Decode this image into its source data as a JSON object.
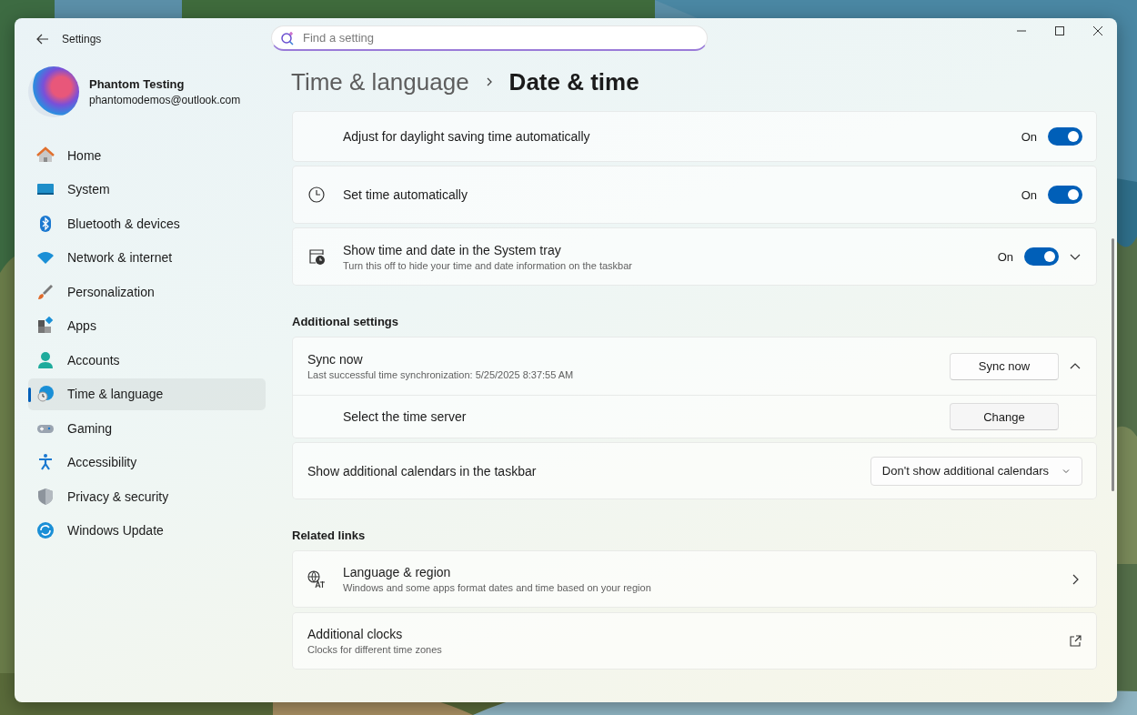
{
  "window": {
    "title": "Settings"
  },
  "search": {
    "placeholder": "Find a setting"
  },
  "account": {
    "name": "Phantom Testing",
    "email": "phantomodemos@outlook.com"
  },
  "sidebar": {
    "items": [
      {
        "label": "Home",
        "selected": false
      },
      {
        "label": "System",
        "selected": false
      },
      {
        "label": "Bluetooth & devices",
        "selected": false
      },
      {
        "label": "Network & internet",
        "selected": false
      },
      {
        "label": "Personalization",
        "selected": false
      },
      {
        "label": "Apps",
        "selected": false
      },
      {
        "label": "Accounts",
        "selected": false
      },
      {
        "label": "Time & language",
        "selected": true
      },
      {
        "label": "Gaming",
        "selected": false
      },
      {
        "label": "Accessibility",
        "selected": false
      },
      {
        "label": "Privacy & security",
        "selected": false
      },
      {
        "label": "Windows Update",
        "selected": false
      }
    ]
  },
  "breadcrumb": {
    "parent": "Time & language",
    "current": "Date & time"
  },
  "content": [
    {
      "kind": "toggle",
      "label": "Adjust for daylight saving time automatically",
      "state_text": "On",
      "on": true
    },
    {
      "kind": "toggle",
      "label": "Set time automatically",
      "state_text": "On",
      "on": true
    },
    {
      "kind": "toggle",
      "label": "Show time and date in the System tray",
      "description": "Turn this off to hide your time and date information on the taskbar",
      "state_text": "On",
      "on": true,
      "expanded": false
    },
    {
      "kind": "section",
      "label": "Additional settings"
    },
    {
      "kind": "expander",
      "label": "Sync now",
      "description": "Last successful time synchronization: 5/25/2025 8:37:55 AM",
      "button": "Sync now",
      "expanded": true,
      "children": [
        {
          "label": "Select the time server",
          "button": "Change"
        }
      ]
    },
    {
      "kind": "dropdown",
      "label": "Show additional calendars in the taskbar",
      "value": "Don't show additional calendars"
    },
    {
      "kind": "section",
      "label": "Related links"
    },
    {
      "kind": "link",
      "label": "Language & region",
      "description": "Windows and some apps format dates and time based on your region"
    },
    {
      "kind": "external_link",
      "label": "Additional clocks",
      "description": "Clocks for different time zones"
    }
  ]
}
